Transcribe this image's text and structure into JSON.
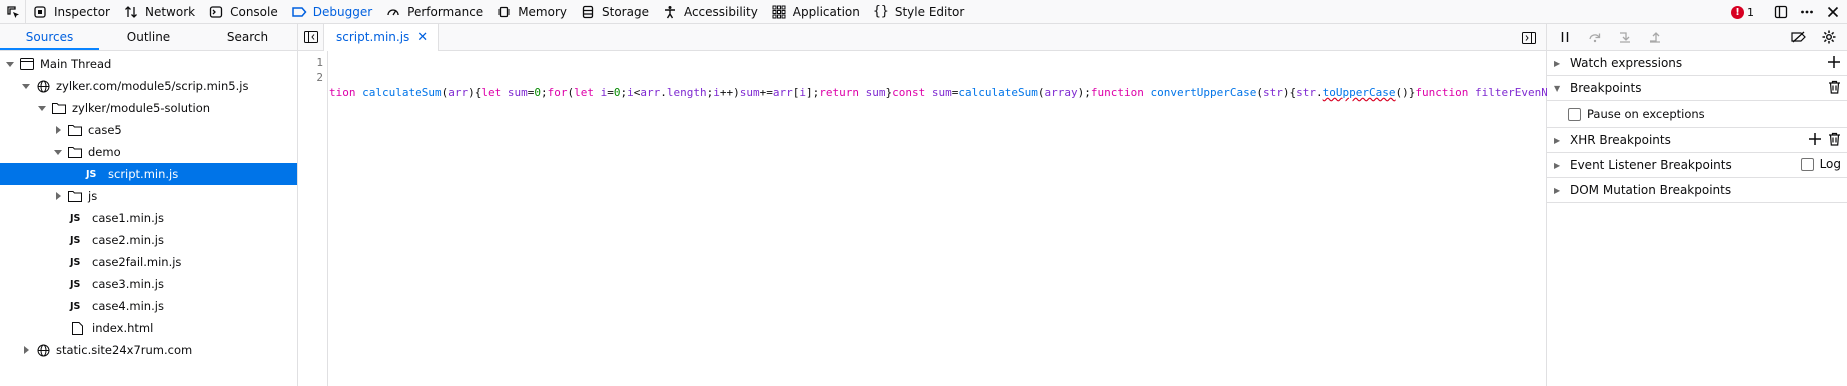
{
  "toolbar": {
    "tabs": [
      {
        "label": "Inspector",
        "icon": "inspector-icon"
      },
      {
        "label": "Network",
        "icon": "network-icon"
      },
      {
        "label": "Console",
        "icon": "console-icon"
      },
      {
        "label": "Debugger",
        "icon": "debugger-icon"
      },
      {
        "label": "Performance",
        "icon": "performance-icon"
      },
      {
        "label": "Memory",
        "icon": "memory-icon"
      },
      {
        "label": "Storage",
        "icon": "storage-icon"
      },
      {
        "label": "Accessibility",
        "icon": "accessibility-icon"
      },
      {
        "label": "Application",
        "icon": "application-icon"
      },
      {
        "label": "Style Editor",
        "icon": "style-editor-icon"
      }
    ],
    "active_tab": "Debugger",
    "error_count": "1"
  },
  "sources_panel": {
    "tabs": [
      "Sources",
      "Outline",
      "Search"
    ],
    "active_tab": "Sources",
    "tree": [
      {
        "label": "Main Thread",
        "type": "thread",
        "expanded": true
      },
      {
        "label": "zylker.com/module5/scrip.min5.js",
        "type": "domain",
        "expanded": true
      },
      {
        "label": "zylker/module5-solution",
        "type": "folder",
        "expanded": true
      },
      {
        "label": "case5",
        "type": "folder",
        "expanded": false
      },
      {
        "label": "demo",
        "type": "folder",
        "expanded": true
      },
      {
        "label": "script.min.js",
        "type": "js",
        "selected": true
      },
      {
        "label": "js",
        "type": "folder",
        "expanded": false
      },
      {
        "label": "case1.min.js",
        "type": "js"
      },
      {
        "label": "case2.min.js",
        "type": "js"
      },
      {
        "label": "case2fail.min.js",
        "type": "js"
      },
      {
        "label": "case3.min.js",
        "type": "js"
      },
      {
        "label": "case4.min.js",
        "type": "js"
      },
      {
        "label": "index.html",
        "type": "file"
      },
      {
        "label": "static.site24x7rum.com",
        "type": "domain",
        "expanded": false
      }
    ],
    "js_badge": "JS"
  },
  "editor": {
    "open_tab": "script.min.js",
    "line_numbers": [
      "1",
      "2"
    ],
    "code_line_1": "tion calculateSum(arr){let sum=0;for(let i=0;i<arr.length;i++)sum+=arr[i];return sum}const sum=calculateSum(array);function convertUpperCase(str){str.toUpperCase()}function filterEvenN"
  },
  "breakpoints_panel": {
    "sections": {
      "watch": "Watch expressions",
      "breakpoints": "Breakpoints",
      "pause_on_exceptions": "Pause on exceptions",
      "xhr": "XHR Breakpoints",
      "event_listener": "Event Listener Breakpoints",
      "log": "Log",
      "dom_mutation": "DOM Mutation Breakpoints"
    }
  },
  "colors": {
    "accent": "#0060df",
    "selection": "#0074e8",
    "error": "#d70022"
  }
}
